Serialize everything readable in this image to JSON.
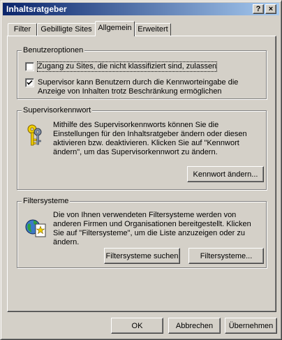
{
  "window": {
    "title": "Inhaltsratgeber",
    "help_glyph": "?",
    "close_glyph": "×",
    "titlebar_color_start": "#0a246a",
    "titlebar_color_end": "#a6caf0"
  },
  "tabs": [
    {
      "label": "Filter",
      "active": false
    },
    {
      "label": "Gebilligte Sites",
      "active": false
    },
    {
      "label": "Allgemein",
      "active": true
    },
    {
      "label": "Erweitert",
      "active": false
    }
  ],
  "user_options": {
    "legend": "Benutzeroptionen",
    "allow_unrated": {
      "label": "Zugang zu Sites, die nicht klassifiziert sind, zulassen",
      "checked": false
    },
    "supervisor_override": {
      "line1": "Supervisor kann Benutzern durch die Kennworteingabe die",
      "line2": "Anzeige von Inhalten trotz Beschränkung ermöglichen",
      "checked": true
    }
  },
  "supervisor_password": {
    "legend": "Supervisorkennwort",
    "icon": "key-icon",
    "description": [
      "Mithilfe des Supervisorkennworts können Sie die",
      "Einstellungen für den Inhaltsratgeber ändern oder diesen",
      "aktivieren bzw. deaktivieren. Klicken Sie auf \"Kennwort",
      "ändern\", um das Supervisorkennwort zu ändern."
    ],
    "change_button": "Kennwort ändern..."
  },
  "rating_systems": {
    "legend": "Filtersysteme",
    "icon": "globe-document-icon",
    "description": [
      "Die von Ihnen verwendeten Filtersysteme werden von",
      "anderen Firmen und Organisationen bereitgestellt. Klicken",
      "Sie auf \"Filtersysteme\", um die Liste anzuzeigen oder zu",
      "ändern."
    ],
    "find_button": "Filtersysteme suchen",
    "systems_button": "Filtersysteme..."
  },
  "footer": {
    "ok": "OK",
    "cancel": "Abbrechen",
    "apply": "Übernehmen"
  }
}
